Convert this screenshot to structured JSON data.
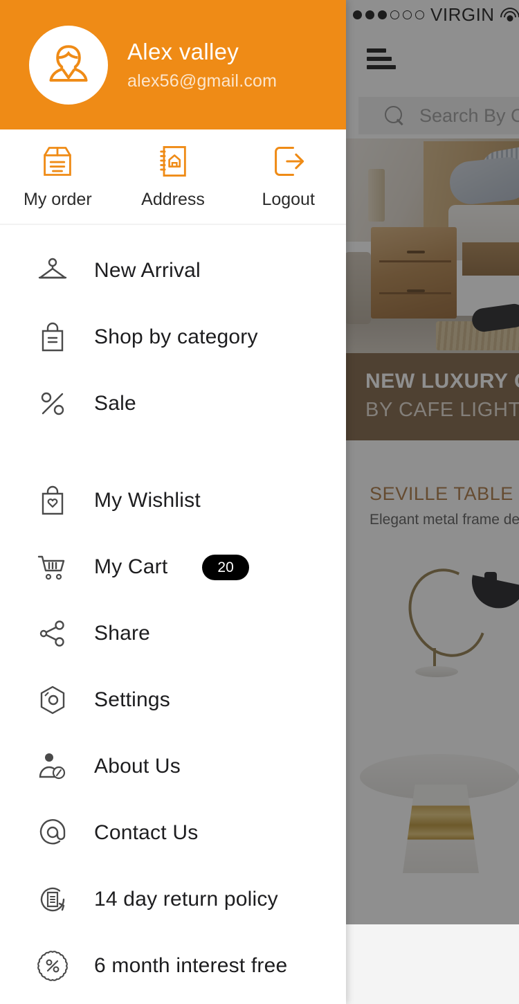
{
  "status_bar": {
    "signal_filled": 3,
    "signal_empty": 3,
    "carrier": "VIRGIN",
    "wifi_icon": "wifi-icon"
  },
  "navbar": {
    "menu_icon": "hamburger-menu-icon"
  },
  "search": {
    "icon": "search-icon",
    "placeholder": "Search By Category"
  },
  "hero_banner": {
    "image_alt": "bedroom-scene",
    "title": "NEW LUXURY COLLECTION",
    "subtitle": "BY CAFE  LIGHTING"
  },
  "product": {
    "title": "SEVILLE TABLE LAMP",
    "subtitle": "Elegant metal frame design",
    "image_alt": "seville-table-lamp",
    "second_image_alt": "round-side-table"
  },
  "drawer": {
    "profile": {
      "avatar_icon": "user-avatar-icon",
      "name": "Alex valley",
      "email": "alex56@gmail.com"
    },
    "quick_actions": [
      {
        "label": "My order",
        "icon": "package-box-icon"
      },
      {
        "label": "Address",
        "icon": "address-book-icon"
      },
      {
        "label": "Logout",
        "icon": "logout-arrow-icon"
      }
    ],
    "menu_groups": [
      {
        "items": [
          {
            "label": "New Arrival",
            "icon": "clothes-hanger-icon"
          },
          {
            "label": "Shop by category",
            "icon": "shopping-bag-icon"
          },
          {
            "label": "Sale",
            "icon": "percent-icon"
          }
        ]
      },
      {
        "items": [
          {
            "label": "My Wishlist",
            "icon": "bag-heart-icon"
          },
          {
            "label": "My Cart",
            "icon": "shopping-cart-icon",
            "badge": "20"
          },
          {
            "label": "Share",
            "icon": "share-nodes-icon"
          },
          {
            "label": "Settings",
            "icon": "hexagon-gear-icon"
          },
          {
            "label": "About Us",
            "icon": "person-info-icon"
          },
          {
            "label": "Contact Us",
            "icon": "at-sign-icon"
          },
          {
            "label": "14 day return policy",
            "icon": "document-return-icon"
          },
          {
            "label": "6 month interest free",
            "icon": "percent-badge-icon"
          }
        ]
      }
    ]
  },
  "colors": {
    "accent": "#ef8b16",
    "badge": "#000000",
    "banner_bg": "#7a5c3e",
    "product_title": "#a8713a",
    "menu_text": "#1d1d1f"
  }
}
